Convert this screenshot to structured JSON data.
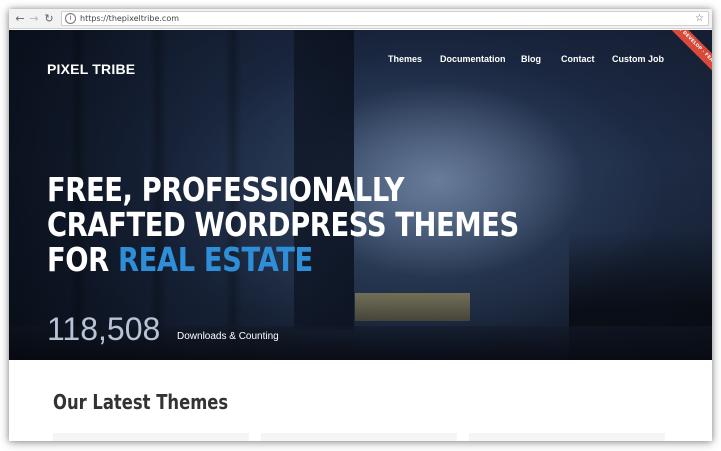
{
  "browser": {
    "back_icon": "back-arrow-icon",
    "forward_icon": "forward-arrow-icon",
    "reload_icon": "reload-icon",
    "url": "https://thepixeltribe.com",
    "info_icon": "info-icon",
    "bookmark_icon": "star-icon"
  },
  "header": {
    "logo": "PIXEL TRIBE",
    "nav": [
      {
        "label": "Themes"
      },
      {
        "label": "Documentation"
      },
      {
        "label": "Blog"
      },
      {
        "label": "Contact"
      },
      {
        "label": "Custom Job"
      }
    ],
    "ribbon": "WE DEVELOP · FEATURED"
  },
  "hero": {
    "line1": "FREE, PROFESSIONALLY",
    "line2": "CRAFTED WORDPRESS THEMES",
    "line3_prefix": "FOR ",
    "line3_accent": "REAL ESTATE",
    "accent_color": "#2e8fd8",
    "count": "118,508",
    "count_label": "Downloads & Counting"
  },
  "latest": {
    "title": "Our Latest Themes"
  }
}
